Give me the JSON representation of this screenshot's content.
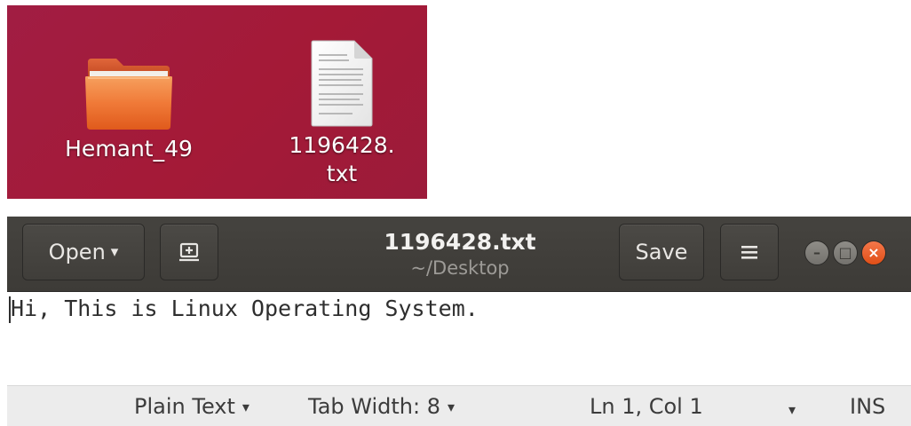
{
  "desktop": {
    "background_color": "#a11d43",
    "items": [
      {
        "label": "Hemant_49",
        "icon": "folder-icon",
        "icon_color": "#f37a3a"
      },
      {
        "label_line1": "1196428.",
        "label_line2": "txt",
        "icon": "text-file-icon"
      }
    ]
  },
  "editor": {
    "headerbar": {
      "open_label": "Open",
      "open_caret": "▾",
      "new_tab_icon": "new-tab-icon",
      "title": "1196428.txt",
      "subtitle": "~/Desktop",
      "save_label": "Save",
      "menu_icon": "hamburger-menu-icon",
      "controls": {
        "minimize": "–",
        "maximize": "□",
        "close": "×"
      }
    },
    "content": "Hi, This is Linux Operating System.",
    "statusbar": {
      "language": "Plain Text",
      "tab_width": "Tab Width: 8",
      "position": "Ln 1, Col 1",
      "mode": "INS",
      "caret": "▾"
    }
  },
  "colors": {
    "headerbar": "#3f3d39",
    "close_button": "#e95420",
    "statusbar": "#ececec"
  }
}
